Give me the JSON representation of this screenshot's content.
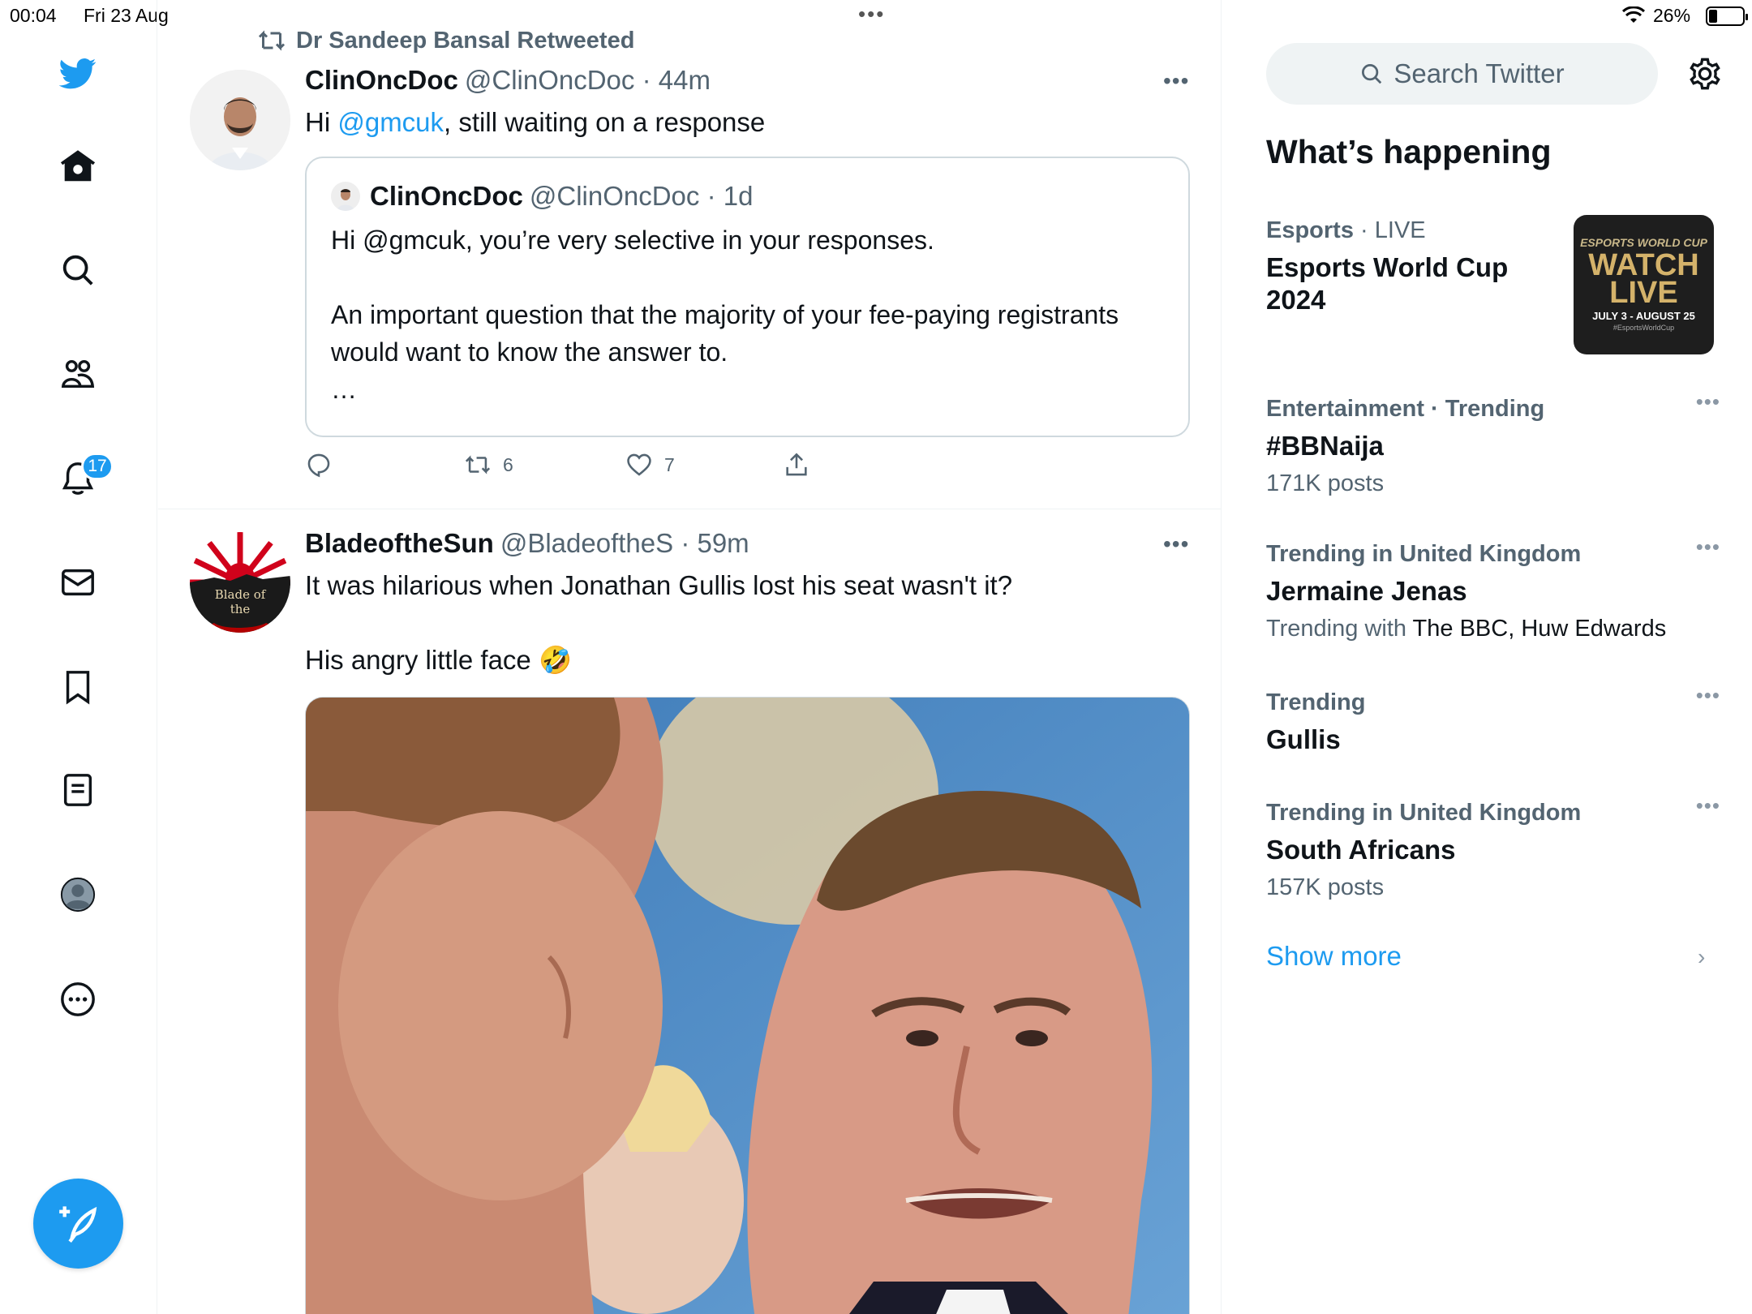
{
  "statusbar": {
    "time": "00:04",
    "date": "Fri 23 Aug",
    "battery_pct": "26%",
    "battery_level": 0.26
  },
  "nav": {
    "notifications_badge": "17"
  },
  "tweets": [
    {
      "retweeted_by": "Dr Sandeep Bansal Retweeted",
      "name": "ClinOncDoc",
      "handle_time": "@ClinOncDoc · 44m",
      "text_before": "Hi ",
      "mention": "@gmcuk",
      "text_after": ", still waiting on a response",
      "quote": {
        "name": "ClinOncDoc",
        "handle_time": "@ClinOncDoc · 1d",
        "text": "Hi @gmcuk, you’re very selective in your responses.\n\nAn important question that the majority of your fee-paying registrants would want to know the answer to.\n…"
      },
      "retweets": "6",
      "likes": "7"
    },
    {
      "name": "BladeoftheSun",
      "handle_time": "@BladeoftheS · 59m",
      "text": "It was hilarious when Jonathan Gullis lost his seat wasn't it?\n\nHis angry little face 🤣",
      "avatar_text": "Blade of the"
    }
  ],
  "sidebar": {
    "search_placeholder": "Search Twitter",
    "section_title": "What’s happening",
    "trends": [
      {
        "category": "Esports",
        "sep": " · ",
        "status": "LIVE",
        "title": "Esports World Cup 2024"
      },
      {
        "meta": "Entertainment · Trending",
        "title": "#BBNaija",
        "sub": "171K posts"
      },
      {
        "meta": "Trending in United Kingdom",
        "title": "Jermaine Jenas",
        "sub_prefix": "Trending with ",
        "sub_dark": "The BBC, Huw Edwards"
      },
      {
        "meta": "Trending",
        "title": "Gullis"
      },
      {
        "meta": "Trending in United Kingdom",
        "title": "South Africans",
        "sub": "157K posts"
      }
    ],
    "thumb": {
      "top": "ESPORTS WORLD CUP",
      "main": "WATCH LIVE",
      "dates": "JULY 3 - AUGUST 25",
      "tag": "#EsportsWorldCup"
    },
    "show_more": "Show more"
  },
  "colors": {
    "accent": "#1d9bf0",
    "secondary_text": "#536471",
    "primary_text": "#0f1419"
  }
}
